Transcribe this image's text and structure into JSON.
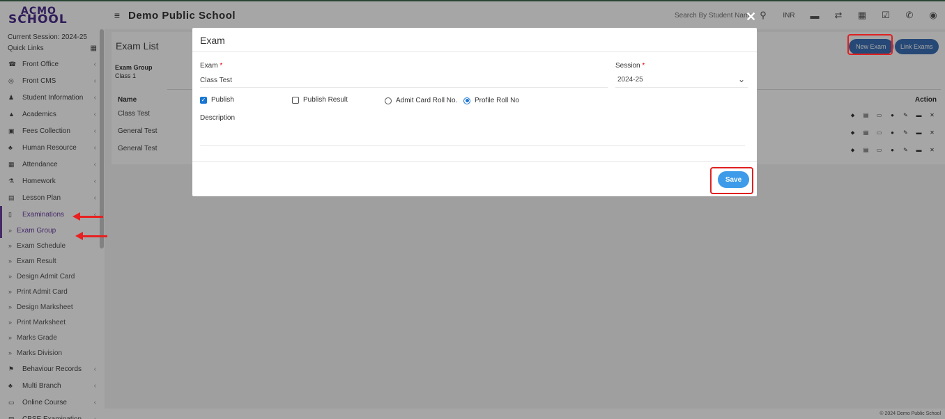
{
  "header": {
    "logo_line1": "ACMO",
    "logo_line2": "SCHOOL",
    "school_name": "Demo Public School",
    "search_placeholder": "Search By Student Name",
    "currency": "INR"
  },
  "sidebar": {
    "session": "Current Session: 2024-25",
    "quick_links": "Quick Links",
    "items": [
      {
        "label": "Front Office",
        "icon": "front-office-icon"
      },
      {
        "label": "Front CMS",
        "icon": "cms-icon"
      },
      {
        "label": "Student Information",
        "icon": "student-icon"
      },
      {
        "label": "Academics",
        "icon": "academics-icon"
      },
      {
        "label": "Fees Collection",
        "icon": "fees-icon"
      },
      {
        "label": "Human Resource",
        "icon": "hr-icon"
      },
      {
        "label": "Attendance",
        "icon": "calendar-icon"
      },
      {
        "label": "Homework",
        "icon": "flask-icon"
      },
      {
        "label": "Lesson Plan",
        "icon": "lesson-icon"
      },
      {
        "label": "Examinations",
        "icon": "map-icon"
      }
    ],
    "sub_items": [
      "Exam Group",
      "Exam Schedule",
      "Exam Result",
      "Design Admit Card",
      "Print Admit Card",
      "Design Marksheet",
      "Print Marksheet",
      "Marks Grade",
      "Marks Division"
    ],
    "items_after": [
      {
        "label": "Behaviour Records",
        "icon": "sign-icon"
      },
      {
        "label": "Multi Branch",
        "icon": "branch-icon"
      },
      {
        "label": "Online Course",
        "icon": "course-icon"
      },
      {
        "label": "CBSE Examination",
        "icon": "cbse-icon"
      }
    ]
  },
  "content": {
    "title": "Exam List",
    "exam_group_label": "Exam Group",
    "exam_group_value": "Class 1",
    "new_exam": "New Exam",
    "link_exams": "Link Exams",
    "col_name": "Name",
    "col_action": "Action",
    "rows": [
      "Class Test",
      "General Test",
      "General Test"
    ]
  },
  "modal": {
    "title": "Exam",
    "exam_label": "Exam",
    "exam_value": "Class Test",
    "session_label": "Session",
    "session_value": "2024-25",
    "publish": "Publish",
    "publish_result": "Publish Result",
    "admit_card_roll": "Admit Card Roll No.",
    "profile_roll": "Profile Roll No",
    "description_label": "Description",
    "description_value": "",
    "save": "Save"
  },
  "footer": "© 2024 Demo Public School",
  "colors": {
    "accent": "#6b3fa0",
    "primary_button": "#3b6fb6",
    "save_button": "#3d9be9",
    "highlight": "#e02020"
  }
}
